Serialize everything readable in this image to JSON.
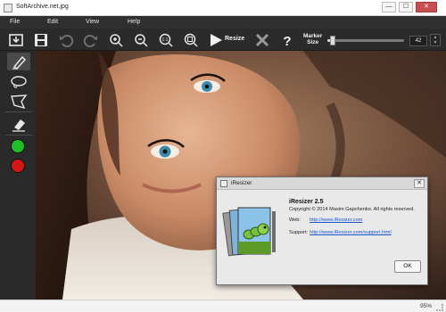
{
  "window": {
    "title": "SoftArchive.net.jpg",
    "minimize_symbol": "—",
    "maximize_symbol": "☐",
    "close_symbol": "✕"
  },
  "menu": [
    {
      "label": "File"
    },
    {
      "label": "Edit"
    },
    {
      "label": "View"
    },
    {
      "label": "Help"
    }
  ],
  "toolbar": {
    "icons": [
      "open-icon",
      "save-icon",
      "undo-icon",
      "redo-icon",
      "zoom-in-icon",
      "zoom-out-icon",
      "actual-size-icon",
      "fit-to-window-icon",
      "play-icon",
      "delete-icon",
      "help-icon"
    ],
    "resize_label": "Resize",
    "marker_label_line1": "Marker",
    "marker_label_line2": "Size",
    "marker_size_value": "42",
    "marker_size_level": 0.07,
    "spin_up": "▲",
    "spin_down": "▼"
  },
  "sidebar": {
    "tools": [
      "marker-tool-icon",
      "lasso-tool-icon",
      "polygon-lasso-tool-icon",
      "eraser-tool-icon"
    ],
    "colors": [
      {
        "name": "keep-color",
        "hex": "#1fbf2a"
      },
      {
        "name": "remove-color",
        "hex": "#d41818"
      }
    ]
  },
  "status": {
    "zoom": "95%"
  },
  "dialog": {
    "title": "iResizer",
    "close_symbol": "✕",
    "product": "iResizer 2.5",
    "copyright": "Copyright © 2014 Maxim Gapchenko. All rights reserved.",
    "web_label": "Web:",
    "web_link": "http://www.iResizer.com",
    "support_label": "Support:",
    "support_link": "http://www.iResizer.com/support.html",
    "ok_label": "OK"
  },
  "colors": {
    "toolbar_bg": "#2b2b2b",
    "menubar_bg": "#2f2f2f",
    "dialog_bg": "#f0f0f0",
    "link": "#1a55c9"
  }
}
